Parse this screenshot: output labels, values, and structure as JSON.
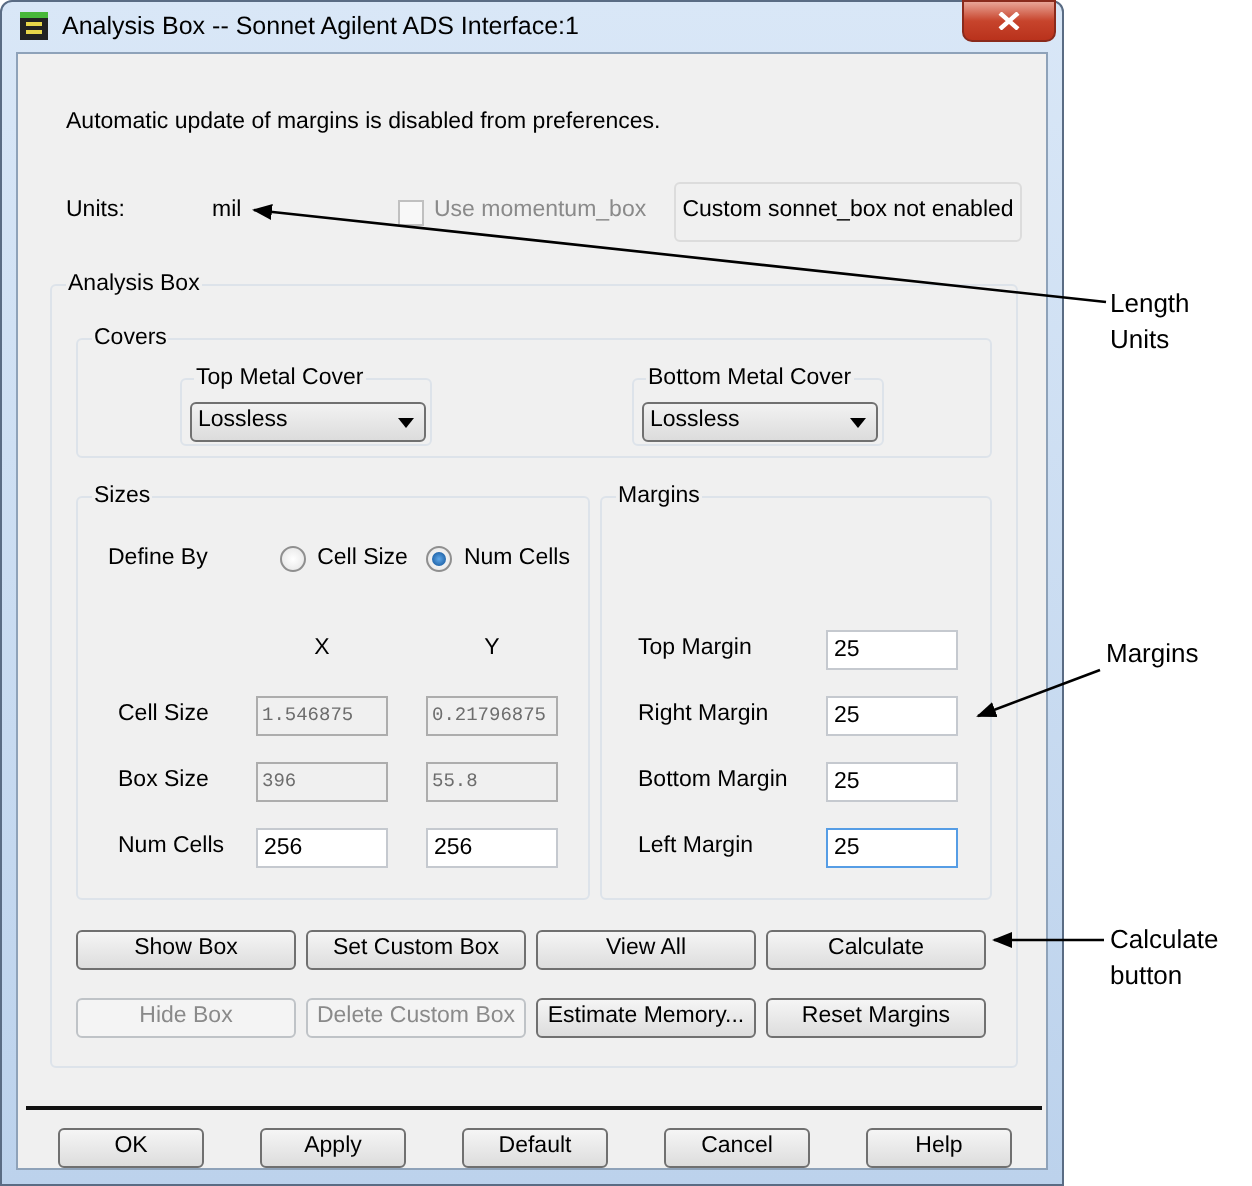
{
  "window": {
    "title": "Analysis Box -- Sonnet Agilent ADS Interface:1"
  },
  "message": "Automatic update of margins is disabled from preferences.",
  "units": {
    "label": "Units:",
    "value": "mil"
  },
  "momentum_box": {
    "label": "Use momentum_box",
    "checked": false,
    "disabled": true
  },
  "custom_status": "Custom sonnet_box not enabled",
  "analysis_box": {
    "title": "Analysis Box",
    "covers": {
      "title": "Covers",
      "items": [
        {
          "title": "Top Metal Cover",
          "value": "Lossless"
        },
        {
          "title": "Bottom Metal Cover",
          "value": "Lossless"
        }
      ]
    },
    "sizes": {
      "title": "Sizes",
      "define_by": {
        "label": "Define By",
        "options": [
          {
            "label": "Cell Size",
            "selected": false
          },
          {
            "label": "Num Cells",
            "selected": true
          }
        ]
      },
      "columns": [
        "X",
        "Y"
      ],
      "rows": [
        {
          "label": "Cell Size",
          "values": [
            "1.546875",
            "0.21796875"
          ],
          "disabled": true
        },
        {
          "label": "Box Size",
          "values": [
            "396",
            "55.8"
          ],
          "disabled": true
        },
        {
          "label": "Num Cells",
          "values": [
            "256",
            "256"
          ],
          "disabled": false
        }
      ]
    },
    "margins": {
      "title": "Margins",
      "rows": [
        {
          "label": "Top Margin",
          "value": "25",
          "focused": false
        },
        {
          "label": "Right Margin",
          "value": "25",
          "focused": false
        },
        {
          "label": "Bottom Margin",
          "value": "25",
          "focused": false
        },
        {
          "label": "Left Margin",
          "value": "25",
          "focused": true
        }
      ]
    },
    "buttons": [
      {
        "label": "Show Box",
        "disabled": false
      },
      {
        "label": "Set Custom Box",
        "disabled": false
      },
      {
        "label": "View All",
        "disabled": false
      },
      {
        "label": "Calculate",
        "disabled": false
      },
      {
        "label": "Hide Box",
        "disabled": true
      },
      {
        "label": "Delete Custom Box",
        "disabled": true
      },
      {
        "label": "Estimate Memory...",
        "disabled": false
      },
      {
        "label": "Reset Margins",
        "disabled": false
      }
    ]
  },
  "footer_buttons": [
    "OK",
    "Apply",
    "Default",
    "Cancel",
    "Help"
  ],
  "annotations": [
    {
      "text": "Length Units"
    },
    {
      "text": "Margins"
    },
    {
      "text": "Calculate button"
    }
  ]
}
